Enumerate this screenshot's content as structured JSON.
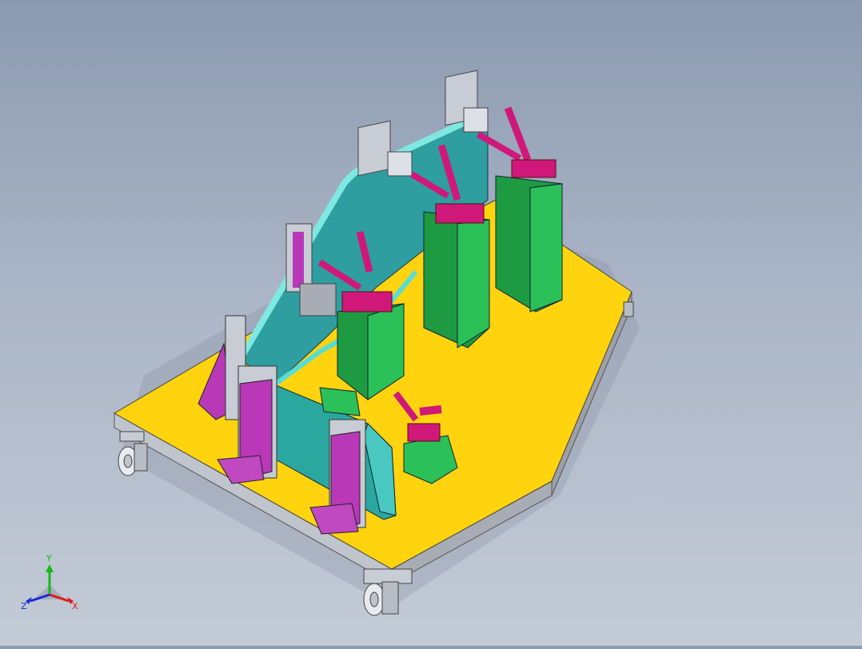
{
  "triad": {
    "x_label": "X",
    "y_label": "Y",
    "z_label": "Z",
    "x_color": "#e01818",
    "y_color": "#18b818",
    "z_color": "#1828d8"
  },
  "colors": {
    "base_top": "#ffd40f",
    "base_edge": "#b8bcc4",
    "frame_cyan": "#3ab8b4",
    "block_green": "#22a844",
    "clamp_magenta": "#d0187a",
    "bracket_purple": "#b838b8",
    "plate_gray": "#c8ccd4"
  }
}
